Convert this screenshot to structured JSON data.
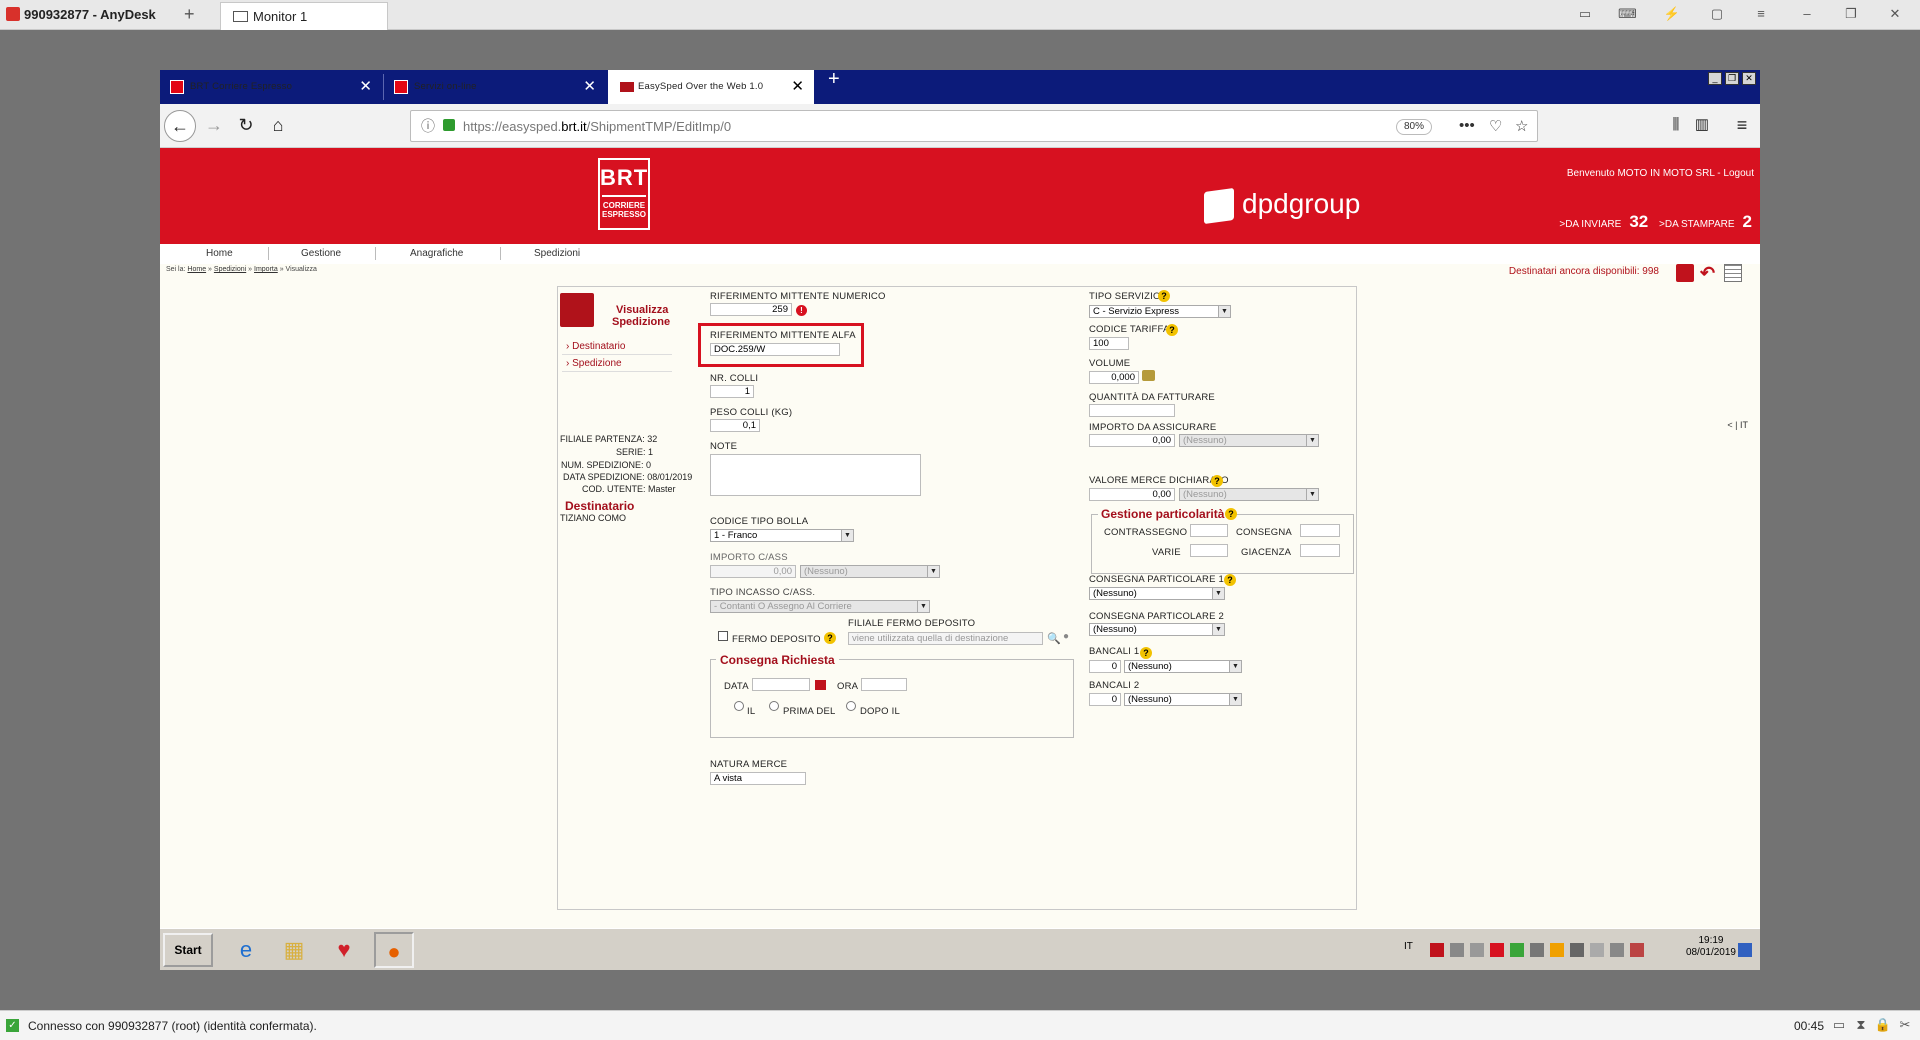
{
  "anydesk": {
    "title": "990932877 - AnyDesk",
    "new_tab": "+",
    "monitor_tab": "Monitor 1",
    "status_text": "Connesso con 990932877 (root) (identità confermata).",
    "session_time": "00:45"
  },
  "browser": {
    "tabs": [
      {
        "label": "BRT Corriere Espresso",
        "close": "✕"
      },
      {
        "label": "Servizi on-line",
        "close": "✕"
      },
      {
        "label": "EasySped Over the Web 1.0",
        "close": "✕"
      }
    ],
    "new_tab": "+",
    "url_prefix": "https://easysped.",
    "url_domain": "brt.it",
    "url_path": "/ShipmentTMP/EditImp/0",
    "zoom": "80%"
  },
  "header": {
    "logo_main": "BRT",
    "logo_sub1": "CORRIERE",
    "logo_sub2": "ESPRESSO",
    "dpd": "dpdgroup",
    "welcome": "Benvenuto MOTO IN MOTO SRL -",
    "logout": "Logout",
    "da_inviare_label": "DA INVIARE",
    "da_inviare_count": "32",
    "da_stampare_label": "DA STAMPARE",
    "da_stampare_count": "2"
  },
  "menu": {
    "items": [
      "Home",
      "Gestione",
      "Anagrafiche",
      "Spedizioni"
    ],
    "lang": "IT"
  },
  "breadcrumb": {
    "prefix": "Sei la:",
    "home": "Home",
    "spedizioni": "Spedizioni",
    "importa": "Importa",
    "current": "Visualizza"
  },
  "destinatari_disponibili": "Destinatari ancora disponibili: 998",
  "sidebar": {
    "title1": "Visualizza",
    "title2": "Spedizione",
    "links": [
      "Destinatario",
      "Spedizione"
    ],
    "info": [
      {
        "label": "FILIALE PARTENZA:",
        "value": "32"
      },
      {
        "label": "SERIE:",
        "value": "1"
      },
      {
        "label": "NUM. SPEDIZIONE:",
        "value": "0"
      },
      {
        "label": "DATA SPEDIZIONE:",
        "value": "08/01/2019"
      },
      {
        "label": "COD. UTENTE:",
        "value": "Master"
      }
    ],
    "destinatario_title": "Destinatario",
    "destinatario_name": "TIZIANO COMO"
  },
  "form": {
    "rif_num_label": "RIFERIMENTO MITTENTE NUMERICO",
    "rif_num_value": "259",
    "rif_alfa_label": "RIFERIMENTO MITTENTE ALFA",
    "rif_alfa_value": "DOC.259/W",
    "colli_label": "NR. COLLI",
    "colli_value": "1",
    "peso_label": "PESO COLLI (KG)",
    "peso_value": "0,1",
    "note_label": "NOTE",
    "bolla_label": "CODICE TIPO BOLLA",
    "bolla_value": "1 - Franco",
    "cass_label": "IMPORTO C/ASS",
    "cass_value": "0,00",
    "cass_currency": "(Nessuno)",
    "incasso_label": "TIPO INCASSO C/ASS.",
    "incasso_value": "- Contanti O Assegno Al Corriere",
    "fermo_label": "FERMO DEPOSITO",
    "filiale_fermo_label": "FILIALE FERMO DEPOSITO",
    "filiale_fermo_placeholder": "viene utilizzata quella di destinazione",
    "consegna_title": "Consegna Richiesta",
    "data_label": "DATA",
    "ora_label": "ORA",
    "radio_il": "IL",
    "radio_prima": "PRIMA DEL",
    "radio_dopo": "DOPO IL",
    "natura_label": "NATURA MERCE",
    "natura_value": "A vista",
    "servizio_label": "TIPO SERVIZIO",
    "servizio_value": "C - Servizio Express",
    "tariffa_label": "CODICE TARIFFA",
    "tariffa_value": "100",
    "volume_label": "VOLUME",
    "volume_value": "0,000",
    "qta_label": "QUANTITÀ DA FATTURARE",
    "assic_label": "IMPORTO DA ASSICURARE",
    "assic_value": "0,00",
    "assic_currency": "(Nessuno)",
    "valore_label": "VALORE MERCE DICHIARATO",
    "valore_value": "0,00",
    "valore_currency": "(Nessuno)",
    "gestione_title": "Gestione particolarità",
    "contrassegno_label": "CONTRASSEGNO",
    "consegna_label": "CONSEGNA",
    "varie_label": "VARIE",
    "giacenza_label": "GIACENZA",
    "cons_part1_label": "CONSEGNA PARTICOLARE 1",
    "cons_part1_value": "(Nessuno)",
    "cons_part2_label": "CONSEGNA PARTICOLARE 2",
    "cons_part2_value": "(Nessuno)",
    "bancali1_label": "BANCALI 1",
    "bancali1_qty": "0",
    "bancali1_value": "(Nessuno)",
    "bancali2_label": "BANCALI 2",
    "bancali2_qty": "0",
    "bancali2_value": "(Nessuno)"
  },
  "taskbar": {
    "start": "Start",
    "lang": "IT",
    "time": "19:19",
    "date": "08/01/2019"
  },
  "colors": {
    "brt_red": "#d71120",
    "tab_blue": "#0c1b7a",
    "highlight": "#d71120"
  }
}
